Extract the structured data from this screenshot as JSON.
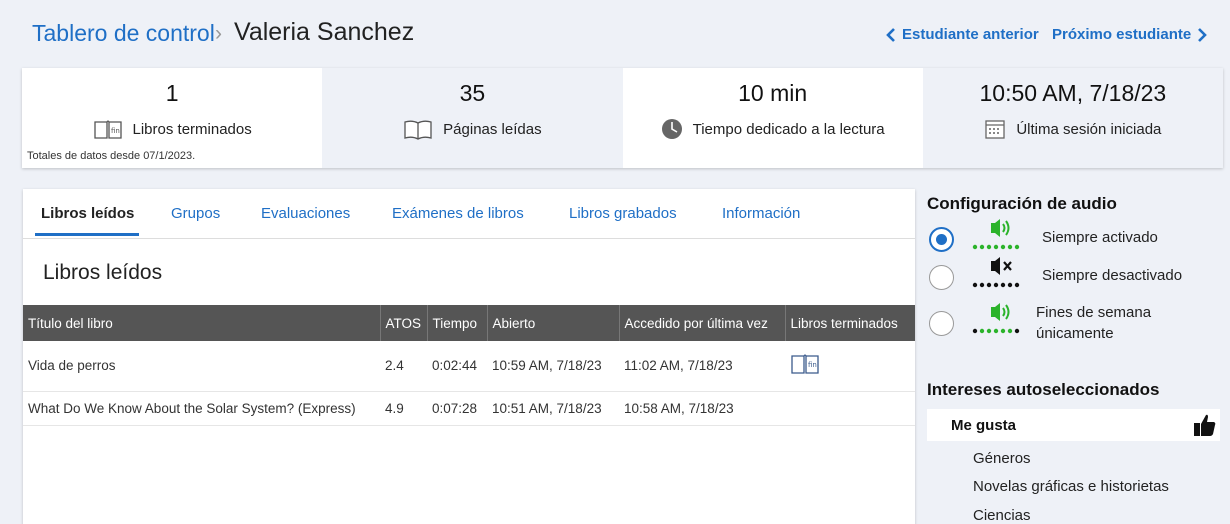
{
  "header": {
    "breadcrumb": "Tablero de control",
    "separator": "›",
    "student_name": "Valeria Sanchez",
    "prev_label": "Estudiante anterior",
    "next_label": "Próximo estudiante"
  },
  "stats": {
    "books_finished": {
      "value": "1",
      "label": "Libros terminados",
      "icon": "book-fin-icon"
    },
    "pages_read": {
      "value": "35",
      "label": "Páginas leídas",
      "icon": "open-book-icon"
    },
    "reading_time": {
      "value": "10 min",
      "label": "Tiempo dedicado a la lectura",
      "icon": "clock-icon"
    },
    "last_session": {
      "value": "10:50 AM, 7/18/23",
      "label": "Última sesión iniciada",
      "icon": "calendar-icon"
    },
    "footnote": "Totales de datos desde 07/1/2023."
  },
  "tabs": [
    {
      "label": "Libros leídos",
      "active": true
    },
    {
      "label": "Grupos"
    },
    {
      "label": "Evaluaciones"
    },
    {
      "label": "Exámenes de libros"
    },
    {
      "label": "Libros grabados"
    },
    {
      "label": "Información"
    }
  ],
  "section_title": "Libros leídos",
  "table": {
    "headers": [
      "Título del libro",
      "ATOS",
      "Tiempo",
      "Abierto",
      "Accedido por última vez",
      "Libros terminados"
    ],
    "rows": [
      {
        "title": "Vida de perros",
        "atos": "2.4",
        "time": "0:02:44",
        "opened": "10:59 AM, 7/18/23",
        "last_access": "11:02 AM, 7/18/23",
        "finished": true
      },
      {
        "title": "What Do We Know About the Solar System? (Express)",
        "atos": "4.9",
        "time": "0:07:28",
        "opened": "10:51 AM, 7/18/23",
        "last_access": "10:58 AM, 7/18/23",
        "finished": false
      }
    ]
  },
  "audio": {
    "title": "Configuración de audio",
    "options": [
      {
        "label": "Siempre activado",
        "selected": true,
        "icon": "speaker-on-icon"
      },
      {
        "label": "Siempre desactivado",
        "selected": false,
        "icon": "speaker-muted-icon"
      },
      {
        "label_line1": "Fines de semana",
        "label_line2": "únicamente",
        "selected": false,
        "icon": "speaker-weekend-icon"
      }
    ]
  },
  "interests": {
    "title": "Intereses autoseleccionados",
    "likes_label": "Me gusta",
    "items": [
      "Géneros",
      "Novelas gráficas e historietas",
      "Ciencias"
    ]
  },
  "colors": {
    "accent": "#1f6fc6",
    "green": "#2bb32b",
    "table_header": "#555555"
  }
}
